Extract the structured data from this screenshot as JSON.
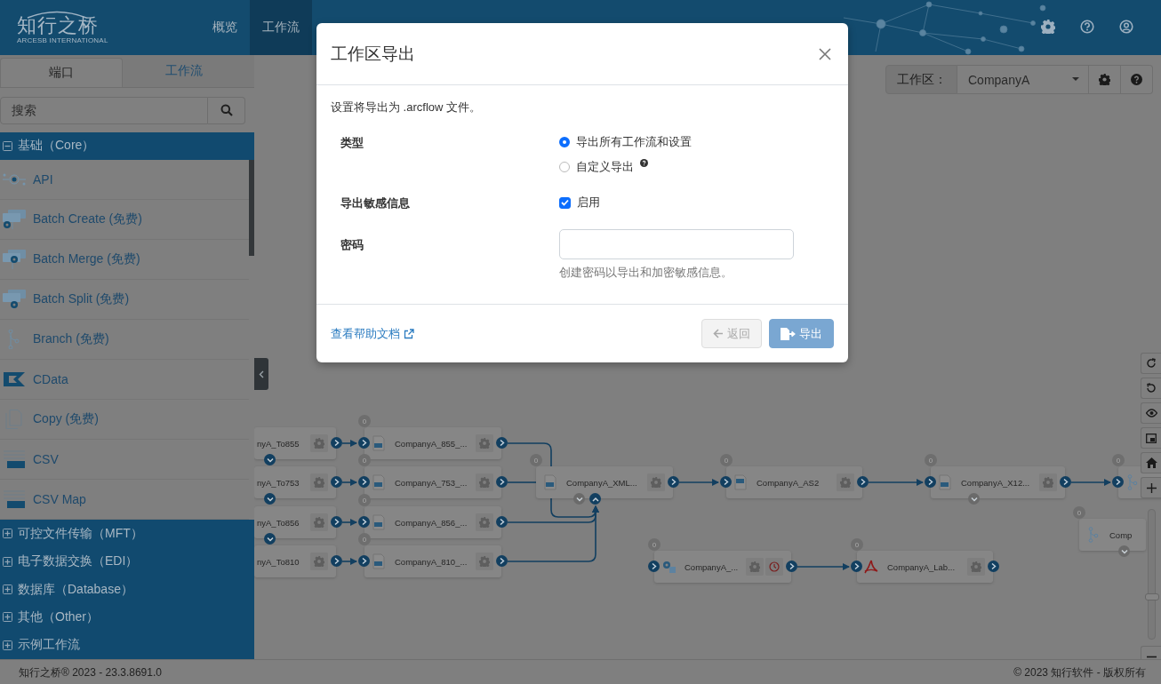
{
  "header": {
    "logo": {
      "name": "知行之桥",
      "tagline": "ARCESB INTERNATIONAL"
    },
    "nav": [
      {
        "label": "概览",
        "selected": false
      },
      {
        "label": "工作流",
        "selected": true
      }
    ]
  },
  "sidebar": {
    "tabs": [
      {
        "label": "端口",
        "selected": true
      },
      {
        "label": "工作流",
        "selected": false
      }
    ],
    "search": {
      "placeholder": "搜索"
    },
    "categories": [
      {
        "label": "基础（Core）",
        "expanded": true,
        "items": [
          {
            "label": "API",
            "kind": "api"
          },
          {
            "label": "Batch Create (免费)",
            "kind": "batch-create"
          },
          {
            "label": "Batch Merge (免费)",
            "kind": "batch-merge"
          },
          {
            "label": "Batch Split (免费)",
            "kind": "batch-split"
          },
          {
            "label": "Branch (免费)",
            "kind": "branch"
          },
          {
            "label": "CData",
            "kind": "cdata"
          },
          {
            "label": "Copy (免费)",
            "kind": "copy"
          },
          {
            "label": "CSV",
            "kind": "csv"
          },
          {
            "label": "CSV Map",
            "kind": "csv-map"
          }
        ]
      },
      {
        "label": "可控文件传输（MFT）",
        "expanded": false
      },
      {
        "label": "电子数据交换（EDI）",
        "expanded": false
      },
      {
        "label": "数据库（Database）",
        "expanded": false
      },
      {
        "label": "其他（Other）",
        "expanded": false
      },
      {
        "label": "示例工作流",
        "expanded": false
      }
    ]
  },
  "workspace_bar": {
    "label": "工作区：",
    "value": "CompanyA"
  },
  "canvas": {
    "nodes": [
      {
        "name": "nyA_To855",
        "input": false,
        "output": true,
        "toggles": [
          {
            "kind": "down",
            "active": true
          }
        ]
      },
      {
        "name": "nyA_To753",
        "input": false,
        "output": true,
        "toggles": [
          {
            "kind": "down",
            "active": true
          }
        ]
      },
      {
        "name": "nyA_To856",
        "input": false,
        "output": true,
        "toggles": [
          {
            "kind": "down",
            "active": true
          }
        ]
      },
      {
        "name": "nyA_To810",
        "input": false,
        "output": true
      },
      {
        "name": "CompanyA_855_...",
        "badge": "0",
        "kind": "edi",
        "input": true,
        "output": true
      },
      {
        "name": "CompanyA_753_...",
        "badge": "0",
        "kind": "edi",
        "input": true,
        "output": true
      },
      {
        "name": "CompanyA_856_...",
        "badge": "0",
        "kind": "edi",
        "input": true,
        "output": true
      },
      {
        "name": "CompanyA_810_...",
        "badge": "0",
        "kind": "edi",
        "input": true,
        "output": true
      },
      {
        "name": "CompanyA_XML...",
        "badge": "0",
        "kind": "xml",
        "input": false,
        "output": true,
        "toggles": [
          {
            "kind": "down",
            "active": false
          },
          {
            "kind": "up",
            "active": true
          }
        ]
      },
      {
        "name": "CompanyA_AS2",
        "badge": "0",
        "kind": "as2",
        "input": true,
        "output": true
      },
      {
        "name": "CompanyA_X12...",
        "badge": "0",
        "kind": "xml",
        "input": true,
        "output": true,
        "toggles": [
          {
            "kind": "down",
            "active": false
          }
        ]
      },
      {
        "badge": "0",
        "kind": "branch",
        "input": true,
        "output": false
      },
      {
        "name": "Comp",
        "badge": "0",
        "kind": "branch",
        "input": false,
        "output": false,
        "toggles": [
          {
            "kind": "down",
            "active": false
          }
        ]
      },
      {
        "name": "CompanyA_...",
        "badge": "0",
        "kind": "api",
        "input": true,
        "output": true,
        "schedule": true
      },
      {
        "name": "CompanyA_Lab...",
        "badge": "0",
        "kind": "pdf",
        "input": true,
        "output": true
      }
    ],
    "zoom": {
      "level": 0.32
    }
  },
  "dialog": {
    "title": "工作区导出",
    "description": "设置将导出为 .arcflow 文件。",
    "fields": [
      {
        "kind": "radio",
        "label": "类型",
        "options": [
          {
            "label": "导出所有工作流和设置",
            "selected": true,
            "help": false
          },
          {
            "label": "自定义导出",
            "selected": false,
            "help": true
          }
        ]
      },
      {
        "kind": "checkbox",
        "label": "导出敏感信息",
        "option": "启用",
        "checked": true
      },
      {
        "kind": "password",
        "label": "密码",
        "hint": "创建密码以导出和加密敏感信息。"
      }
    ],
    "help_link": "查看帮助文档",
    "buttons": [
      {
        "label": "返回",
        "kind": "back",
        "disabled": true
      },
      {
        "label": "导出",
        "kind": "export",
        "disabled": true
      }
    ]
  },
  "footer": {
    "left": "知行之桥® 2023 - 23.3.8691.0",
    "right": "© 2023 知行软件 - 版权所有"
  }
}
